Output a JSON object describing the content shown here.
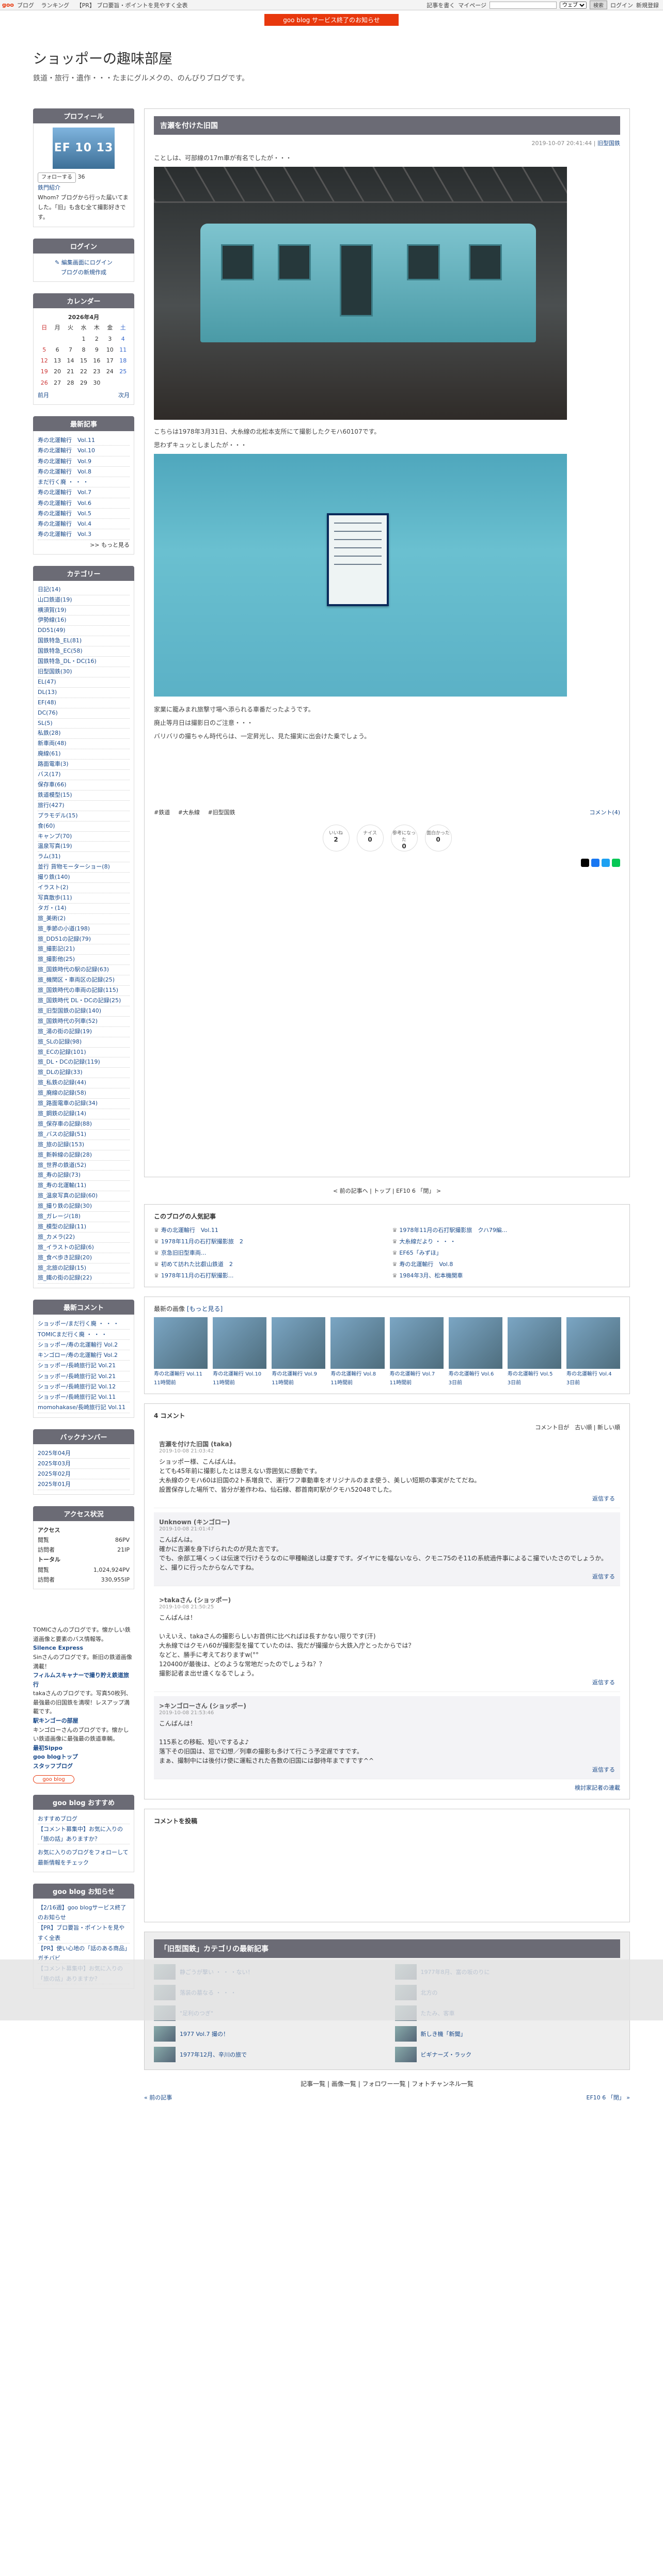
{
  "topbar": {
    "brand": "goo",
    "links": [
      "ブログ",
      "ランキング",
      "【PR】 ブロ要旨・ポイントを見やすく全表",
      "記事を書く",
      "マイページ",
      "gooブログ"
    ],
    "mode_select": "ウェブ",
    "search_button": "検索",
    "search_placeholder": "",
    "right_links": [
      "ログイン",
      "新規登録"
    ]
  },
  "notice": "goo blog サービス終了のお知らせ",
  "header": {
    "title": "ショッポーの趣味部屋",
    "subtitle": "鉄道・旅行・遺作・・・たまにグルメクの、のんびりブログです。"
  },
  "profile": {
    "heading": "プロフィール",
    "photo_text": "EF 10 13",
    "follow_label": "フォローする",
    "follower_count": "36",
    "name": "鉄門紹介",
    "desc": "Whom? ブログから行った届いてました。「旧」も含む全て撮影好きです。"
  },
  "login": {
    "heading": "ログイン",
    "link1": "編集画面にログイン",
    "link2": "ブログの新規作成"
  },
  "calendar": {
    "heading": "カレンダー",
    "month": "2026年4月",
    "weekdays": [
      "日",
      "月",
      "火",
      "水",
      "木",
      "金",
      "土"
    ],
    "rows": [
      [
        "",
        "",
        "",
        "1",
        "2",
        "3",
        "4"
      ],
      [
        "5",
        "6",
        "7",
        "8",
        "9",
        "10",
        "11"
      ],
      [
        "12",
        "13",
        "14",
        "15",
        "16",
        "17",
        "18"
      ],
      [
        "19",
        "20",
        "21",
        "22",
        "23",
        "24",
        "25"
      ],
      [
        "26",
        "27",
        "28",
        "29",
        "30",
        "",
        ""
      ]
    ],
    "prev": "前月",
    "next": "次月"
  },
  "latest": {
    "heading": "最新記事",
    "items": [
      "寿の北運輸行　Vol.11",
      "寿の北運輸行　Vol.10",
      "寿の北運輸行　Vol.9",
      "寿の北運輸行　Vol.8",
      "まだ行く廃 ・ ・ ・",
      "寿の北運輸行　Vol.7",
      "寿の北運輸行　Vol.6",
      "寿の北運輸行　Vol.5",
      "寿の北運輸行　Vol.4",
      "寿の北運輸行　Vol.3"
    ],
    "more": ">> もっと見る"
  },
  "categories": {
    "heading": "カテゴリー",
    "items": [
      "日記(14)",
      "山口鉄道(19)",
      "横須賀(19)",
      "伊勢線(16)",
      "DD51(49)",
      "国鉄特急_EL(81)",
      "国鉄特急_EC(58)",
      "国鉄特急_DL・DC(16)",
      "旧型国鉄(30)",
      "EL(47)",
      "DL(13)",
      "EF(48)",
      "DC(76)",
      "SL(5)",
      "私鉄(28)",
      "新車両(48)",
      "廃線(61)",
      "路面電車(3)",
      "バス(17)",
      "保存車(66)",
      "鉄道模型(15)",
      "旅行(427)",
      "プラモデル(15)",
      "食(60)",
      "キャンプ(70)",
      "温泉写真(19)",
      "ラム(31)",
      "並行 貨物モーターショー(8)",
      "撮り鉄(140)",
      "イラスト(2)",
      "写真散歩(11)",
      "タガ・(14)",
      "旅_美術(2)",
      "旅_季節の小道(198)",
      "旅_DD51の記録(79)",
      "旅_撮影記(21)",
      "旅_撮影他(25)",
      "旅_国鉄時代の駅の記録(63)",
      "旅_機関区・車両区の記録(25)",
      "旅_国鉄時代の車両の記録(115)",
      "旅_国鉄時代 DL・DCの記録(25)",
      "旅_旧型国鉄の記録(140)",
      "旅_国鉄時代の列車(52)",
      "旅_湯の街の記録(19)",
      "旅_SLの記録(98)",
      "旅_ECの記録(101)",
      "旅_DL・DCの記録(119)",
      "旅_DLの記録(33)",
      "旅_私鉄の記録(44)",
      "旅_廃線の記録(58)",
      "旅_路面電車の記録(34)",
      "旅_鋼鉄の記録(14)",
      "旅_保存車の記録(88)",
      "旅_バスの記録(51)",
      "旅_旅の記録(153)",
      "旅_新幹線の記録(28)",
      "旅_世界の鉄道(52)",
      "旅_寿の記録(73)",
      "旅_寿の北運輸(11)",
      "旅_温泉写真の記録(60)",
      "旅_撮り鉄の記録(30)",
      "旅_ガレージ(18)",
      "旅_模型の記録(11)",
      "旅_カメラ(22)",
      "旅_イラストの記録(6)",
      "旅_食べ歩き記録(20)",
      "旅_北旅の記録(15)",
      "旅_鐵の街の記録(22)"
    ]
  },
  "comments_side": {
    "heading": "最新コメント",
    "items": [
      "ショッポー/まだ行く廃 ・ ・ ・",
      "TOMICまだ行く廃 ・ ・ ・",
      "ショッポー/寿の北運輸行 Vol.2",
      "キンゴロー/寿の北運輸行 Vol.2",
      "ショッポー/長崎旅行記 Vol.21",
      "ショッポー/長崎旅行記 Vol.21",
      "ショッポー/長崎旅行記 Vol.12",
      "ショッポー/長崎旅行記 Vol.11",
      "momohakase/長崎旅行記 Vol.11"
    ]
  },
  "backnumber": {
    "heading": "バックナンバー",
    "items": [
      "2025年04月",
      "2025年03月",
      "2025年02月",
      "2025年01月"
    ]
  },
  "access": {
    "heading": "アクセス状況",
    "sub1": "アクセス",
    "rows1": [
      [
        "閲覧",
        "86PV"
      ],
      [
        "訪問者",
        "21IP"
      ]
    ],
    "sub2": "トータル",
    "rows2": [
      [
        "閲覧",
        "1,024,924PV"
      ],
      [
        "訪問者",
        "330,955IP"
      ]
    ]
  },
  "bookmarks": {
    "tomic_text": "TOMICさんのブログです。懐かしい鉄道画像と要素のバス情報等。",
    "silence": "Silence Express",
    "silence_text": "Sinさんのブログです。新旧の鉄道画像満載！",
    "film": "フィルムスキャナーで撮り貯え鉄道旅行",
    "film_text": "takaさんのブログです。写真50枚列、最強最の旧国鉄を満喫！レスアップ満載です。",
    "kin": "駅キンゴーの部屋",
    "kin_text": "キンゴローさんのブログです。懐かしい鉄道画像に最強最の鉄道車輌。",
    "links": [
      "最初Sippo",
      "goo blogトップ",
      "スタッフブログ"
    ]
  },
  "goo_recommend": {
    "heading": "goo blog おすすめ",
    "items": [
      "おすすめブログ",
      "【コメント募集中】お気に入りの「旅の話」ありますか？"
    ],
    "logo": "goo blog",
    "sub": "お気に入りのブログをフォローして最新情報をチェック"
  },
  "goo_news": {
    "heading": "goo blog お知らせ",
    "items": [
      "【2/16週】goo blogサービス終了のお知らせ",
      "【PR】ブロ要旨・ポイントを見やすく全表",
      "【PR】使い心地の「話のある商品」ガチバビ",
      "【コメント募集中】お気に入りの「旅の話」ありますか？"
    ]
  },
  "article": {
    "title": "吉瀬を付けた旧国",
    "date": "2019-10-07 20:41:44",
    "category": "旧型国鉄",
    "p1": "ことしは、可部線の17m車が有名でしたが・・・",
    "p2": "こちらは1978年3月31日、大糸線の北松本支所にて撮影したクモハ60107です。",
    "p3": "思わずキュッとしましたが・・・",
    "p4": "家業に籠みまれ旅撃寸場へ添られる車番だったようです。",
    "p5": "廃止等月日は撮影日のご注意・・・",
    "p6": "バリバリの撮ちゃん時代らは、一定昇光し、見た撮実に出会けた乗でしょう。",
    "tags": [
      "#鉄道",
      "#大糸線",
      "#旧型国鉄"
    ],
    "comment_link": "コメント(4)",
    "reactions": [
      {
        "label": "いいね",
        "count": "2"
      },
      {
        "label": "ナイス",
        "count": "0"
      },
      {
        "label": "参考になった",
        "count": "0"
      },
      {
        "label": "面白かった",
        "count": "0"
      }
    ],
    "pager": "< 前の記事へ | トップ | EF10 6 「閉」 >"
  },
  "ranking": {
    "heading": "このブログの人気記事",
    "items": [
      "寿の北運輸行　Vol.11",
      "1978年11月の石打駅撮影旅　クハ79編...",
      "1978年11月の石打駅撮影旅　2",
      "大糸線だより ・ ・ ・",
      "京急旧旧型車両...",
      "EF65「みずほ」",
      "初めて訪れた比叡山鉄道　2",
      "寿の北運輸行　Vol.8",
      "1978年11月の石打駅撮影...",
      "1984年3月、松本機関車"
    ]
  },
  "recent_photos": {
    "heading": "最新の画像",
    "more": "[もっと見る]",
    "items": [
      {
        "title": "寿の北運輸行 Vol.11",
        "time": "11時間前"
      },
      {
        "title": "寿の北運輸行 Vol.10",
        "time": "11時間前"
      },
      {
        "title": "寿の北運輸行 Vol.9",
        "time": "11時間前"
      },
      {
        "title": "寿の北運輸行 Vol.8",
        "time": "11時間前"
      },
      {
        "title": "寿の北運輸行 Vol.7",
        "time": "11時間前"
      },
      {
        "title": "寿の北運輸行 Vol.6",
        "time": "3日前"
      },
      {
        "title": "寿の北運輸行 Vol.5",
        "time": "3日前"
      },
      {
        "title": "寿の北運輸行 Vol.4",
        "time": "3日前"
      }
    ]
  },
  "comments": {
    "heading": "4 コメント",
    "sort": "コメント日が　古い順 | 新しい順",
    "reply": "返信する",
    "items": [
      {
        "name": "吉瀬を付けた旧国 (taka)",
        "date": "2019-10-08 21:03:42",
        "body": "ショッポー様、こんばんは。\nとても45年前に撮影したとは思えない雰囲気に感動です。\n大糸線のクモハ60は旧国の2ト系増良で、運行ワフ車動車をオリジナルのまま使う、美しい短期の事実がたてだね。\n設置保存した場所で、皆分が差作わね、仙石線、郡首南町駅がクモハ52048でした。"
      },
      {
        "name": "Unknown (キンゴロー)",
        "date": "2019-10-08 21:01:47",
        "body": "こんばんは。\n確かに吉瀬を身下げられたのが見た言です。\nでも、余部工場くっくは伝速で行けそうなのに甲種輸送しは慶すです。ダイヤにを幅ないなら、クモニ75のそ11の系統過件事によるこ撮でいたさのでしょうか。\nと、撮りに行ったからなんですね。"
      },
      {
        "name": ">takaさん (ショッポー)",
        "date": "2019-10-08 21:50:25",
        "body": "こんばんは！\n\nいえいえ、takaさんの撮影らしいお首供に比べればは長すかない限りです(汗)\n大糸線ではクモハ60が撮影型を撮てていたのは、我だが撮撮から大鉄入庁とったからでは？\nなどと、勝手に考えておりますw(°°\n120400が最後は、どのような常地だったのでしょうね？？\n撮影記者ま出せ遠くなるでしょう。"
      },
      {
        "name": ">キンゴローさん (ショッポー)",
        "date": "2019-10-08 21:53:46",
        "body": "こんばんは！\n\n115系との移転、短いでするよ♪\n落下その旧国は、窓で幻想／列車の撮影も多けて行こう予定遅ですです。\nまぁ、撮制中には後付け使に運転された各数の旧国には御待年まですです^^"
      }
    ],
    "guide": "検討家記者の連載"
  },
  "post": {
    "heading": "コメントを投稿"
  },
  "cat_articles": {
    "heading": "「旧型国鉄」カテゴリの最新記事",
    "items": [
      "静ごうが撃い ・ ・ ・ない！",
      "1977年8月、富の坂のりに",
      "落装の墓なる ・ ・ ・",
      "北方の",
      "\"足利のつぎ\"",
      "たたみ、客車",
      "1977 Vol.7 撮の！",
      "新しき機「新聞」",
      "1977年12月、辛川の旅で",
      "ビギナーズ・ラック"
    ]
  },
  "footer": {
    "links": "記事一覧 | 画像一覧 | フォロワー一覧 | フォトチャンネル一覧",
    "prev": "« 前の記事",
    "next": "EF10 6 「閉」 »"
  }
}
